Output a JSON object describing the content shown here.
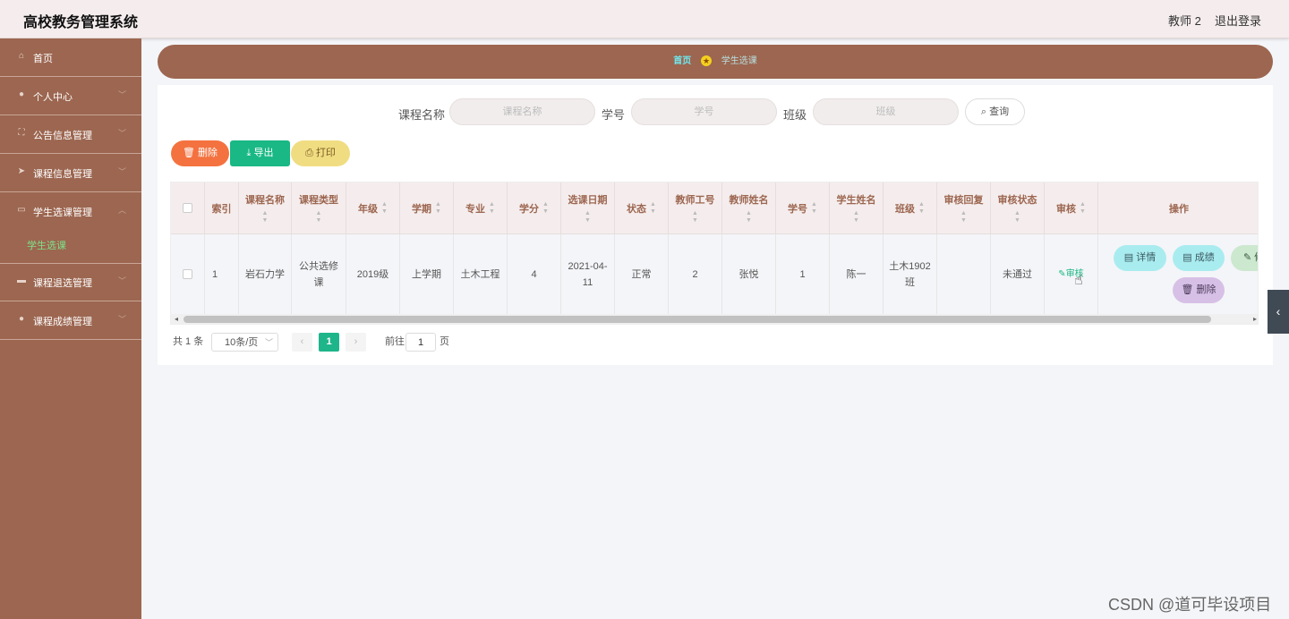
{
  "header": {
    "title": "高校教务管理系统",
    "user": "教师 2",
    "logout": "退出登录"
  },
  "sidebar": {
    "items": [
      {
        "label": "首页",
        "icon": "home-icon"
      },
      {
        "label": "个人中心",
        "icon": "user-icon"
      },
      {
        "label": "公告信息管理",
        "icon": "frame-icon"
      },
      {
        "label": "课程信息管理",
        "icon": "send-icon"
      },
      {
        "label": "学生选课管理",
        "icon": "chat-icon"
      },
      {
        "label": "课程退选管理",
        "icon": "briefcase-icon"
      },
      {
        "label": "课程成绩管理",
        "icon": "user-icon"
      }
    ],
    "active_sub": "学生选课"
  },
  "breadcrumb": {
    "home": "首页",
    "current": "学生选课"
  },
  "search": {
    "course_label": "课程名称",
    "course_placeholder": "课程名称",
    "student_label": "学号",
    "student_placeholder": "学号",
    "class_label": "班级",
    "class_placeholder": "班级",
    "query_label": "查询"
  },
  "actions": {
    "delete": "删除",
    "export": "导出",
    "print": "打印"
  },
  "table": {
    "headers": [
      "索引",
      "课程名称",
      "课程类型",
      "年级",
      "学期",
      "专业",
      "学分",
      "选课日期",
      "状态",
      "教师工号",
      "教师姓名",
      "学号",
      "学生姓名",
      "班级",
      "审核回复",
      "审核状态",
      "审核",
      "操作"
    ],
    "row": {
      "index": "1",
      "course_name": "岩石力学",
      "course_type": "公共选修课",
      "grade": "2019级",
      "term": "上学期",
      "major": "土木工程",
      "credit": "4",
      "date": "2021-04-11",
      "status": "正常",
      "teacher_id": "2",
      "teacher_name": "张悦",
      "student_id": "1",
      "student_name": "陈一",
      "class": "土木1902班",
      "reply": "",
      "review_status": "未通过",
      "review": "审核"
    },
    "ops": {
      "detail": "详情",
      "score": "成绩",
      "edit": "修",
      "delete": "删除"
    }
  },
  "pagination": {
    "total": "共 1 条",
    "page_size": "10条/页",
    "current": "1",
    "goto": "前往",
    "goto_value": "1",
    "page_unit": "页"
  },
  "colors": {
    "brand": "#9c6650",
    "sidebar": "#9c6650",
    "active_page": "#1fb58a",
    "danger": "#f4723f",
    "export": "#19b884",
    "print": "#f0dd82"
  },
  "watermark": "CSDN @道可毕设项目"
}
